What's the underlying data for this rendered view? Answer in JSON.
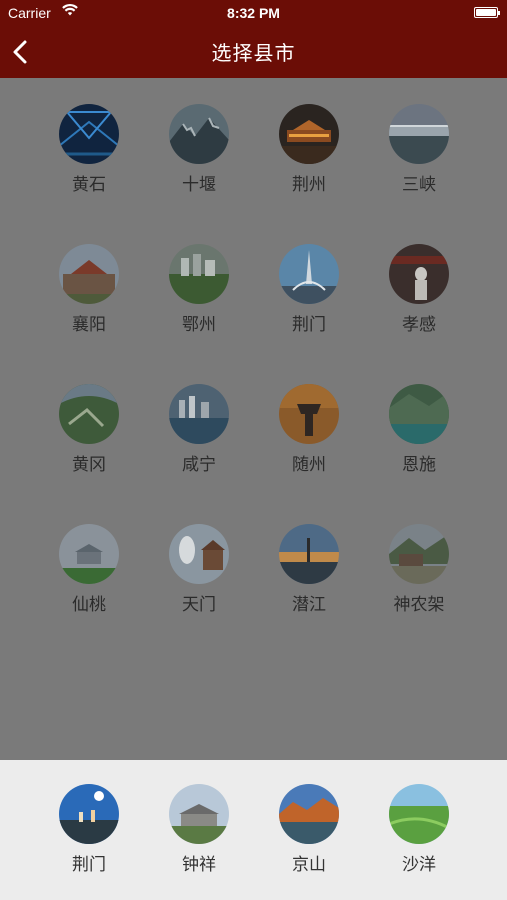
{
  "status_bar": {
    "carrier": "Carrier",
    "time": "8:32 PM"
  },
  "nav": {
    "title": "选择县市",
    "back_icon": "chevron-left-icon"
  },
  "cities": [
    {
      "name": "黄石"
    },
    {
      "name": "十堰"
    },
    {
      "name": "荆州"
    },
    {
      "name": "三峡"
    },
    {
      "name": "襄阳"
    },
    {
      "name": "鄂州"
    },
    {
      "name": "荆门"
    },
    {
      "name": "孝感"
    },
    {
      "name": "黄冈"
    },
    {
      "name": "咸宁"
    },
    {
      "name": "随州"
    },
    {
      "name": "恩施"
    },
    {
      "name": "仙桃"
    },
    {
      "name": "天门"
    },
    {
      "name": "潜江"
    },
    {
      "name": "神农架"
    }
  ],
  "featured": [
    {
      "name": "荆门"
    },
    {
      "name": "钟祥"
    },
    {
      "name": "京山"
    },
    {
      "name": "沙洋"
    }
  ],
  "colors": {
    "nav_bar": "#6b0d06",
    "overlay": "#7a7a7a",
    "bottom_panel": "#ececec"
  }
}
